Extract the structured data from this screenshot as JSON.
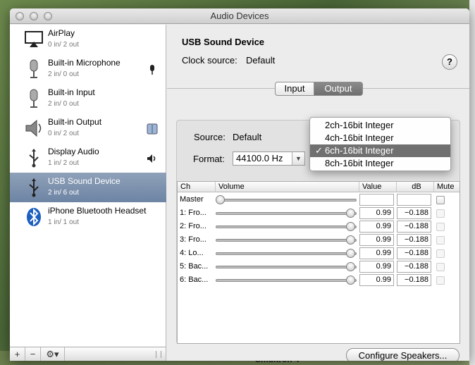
{
  "window": {
    "title": "Audio Devices"
  },
  "devices": [
    {
      "name": "AirPlay",
      "io": "0 in/ 2 out",
      "icon": "airplay-icon"
    },
    {
      "name": "Built-in Microphone",
      "io": "2 in/ 0 out",
      "icon": "microphone-icon",
      "badge": "microphone-badge-icon"
    },
    {
      "name": "Built-in Input",
      "io": "2 in/ 0 out",
      "icon": "microphone-icon"
    },
    {
      "name": "Built-in Output",
      "io": "0 in/ 2 out",
      "icon": "speaker-icon",
      "badge": "finder-badge-icon"
    },
    {
      "name": "Display Audio",
      "io": "1 in/ 2 out",
      "icon": "usb-icon",
      "badge": "speaker-badge-icon"
    },
    {
      "name": "USB Sound Device",
      "io": "2 in/ 6 out",
      "icon": "usb-icon",
      "selected": true
    },
    {
      "name": "iPhone Bluetooth Headset",
      "io": "1 in/ 1 out",
      "icon": "bluetooth-icon"
    }
  ],
  "footer": {
    "add": "+",
    "remove": "−",
    "gear": "⚙▾"
  },
  "detail": {
    "device_title": "USB Sound Device",
    "clock_label": "Clock source:",
    "clock_value": "Default",
    "help": "?",
    "tabs": {
      "input": "Input",
      "output": "Output"
    },
    "source_label": "Source:",
    "source_value": "Default",
    "format_label": "Format:",
    "format_value": "44100.0 Hz"
  },
  "format_menu": {
    "options": [
      "2ch-16bit Integer",
      "4ch-16bit Integer",
      "6ch-16bit Integer",
      "8ch-16bit Integer"
    ],
    "selected_index": 2,
    "checkmark": "✓"
  },
  "table": {
    "headers": {
      "ch": "Ch",
      "volume": "Volume",
      "value": "Value",
      "db": "dB",
      "mute": "Mute"
    },
    "rows": [
      {
        "ch": "Master",
        "value": "",
        "db": "",
        "level": 0.0
      },
      {
        "ch": "1: Fro...",
        "value": "0.99",
        "db": "−0.188",
        "level": 0.99
      },
      {
        "ch": "2: Fro...",
        "value": "0.99",
        "db": "−0.188",
        "level": 0.99
      },
      {
        "ch": "3: Fro...",
        "value": "0.99",
        "db": "−0.188",
        "level": 0.99
      },
      {
        "ch": "4: Lo...",
        "value": "0.99",
        "db": "−0.188",
        "level": 0.99
      },
      {
        "ch": "5: Bac...",
        "value": "0.99",
        "db": "−0.188",
        "level": 0.99
      },
      {
        "ch": "6: Bac...",
        "value": "0.99",
        "db": "−0.188",
        "level": 0.99
      }
    ]
  },
  "configure_button": "Configure Speakers...",
  "background_text": "Smultron 4",
  "colors": {
    "selection": "#7288a8",
    "menu_highlight": "#707070"
  }
}
